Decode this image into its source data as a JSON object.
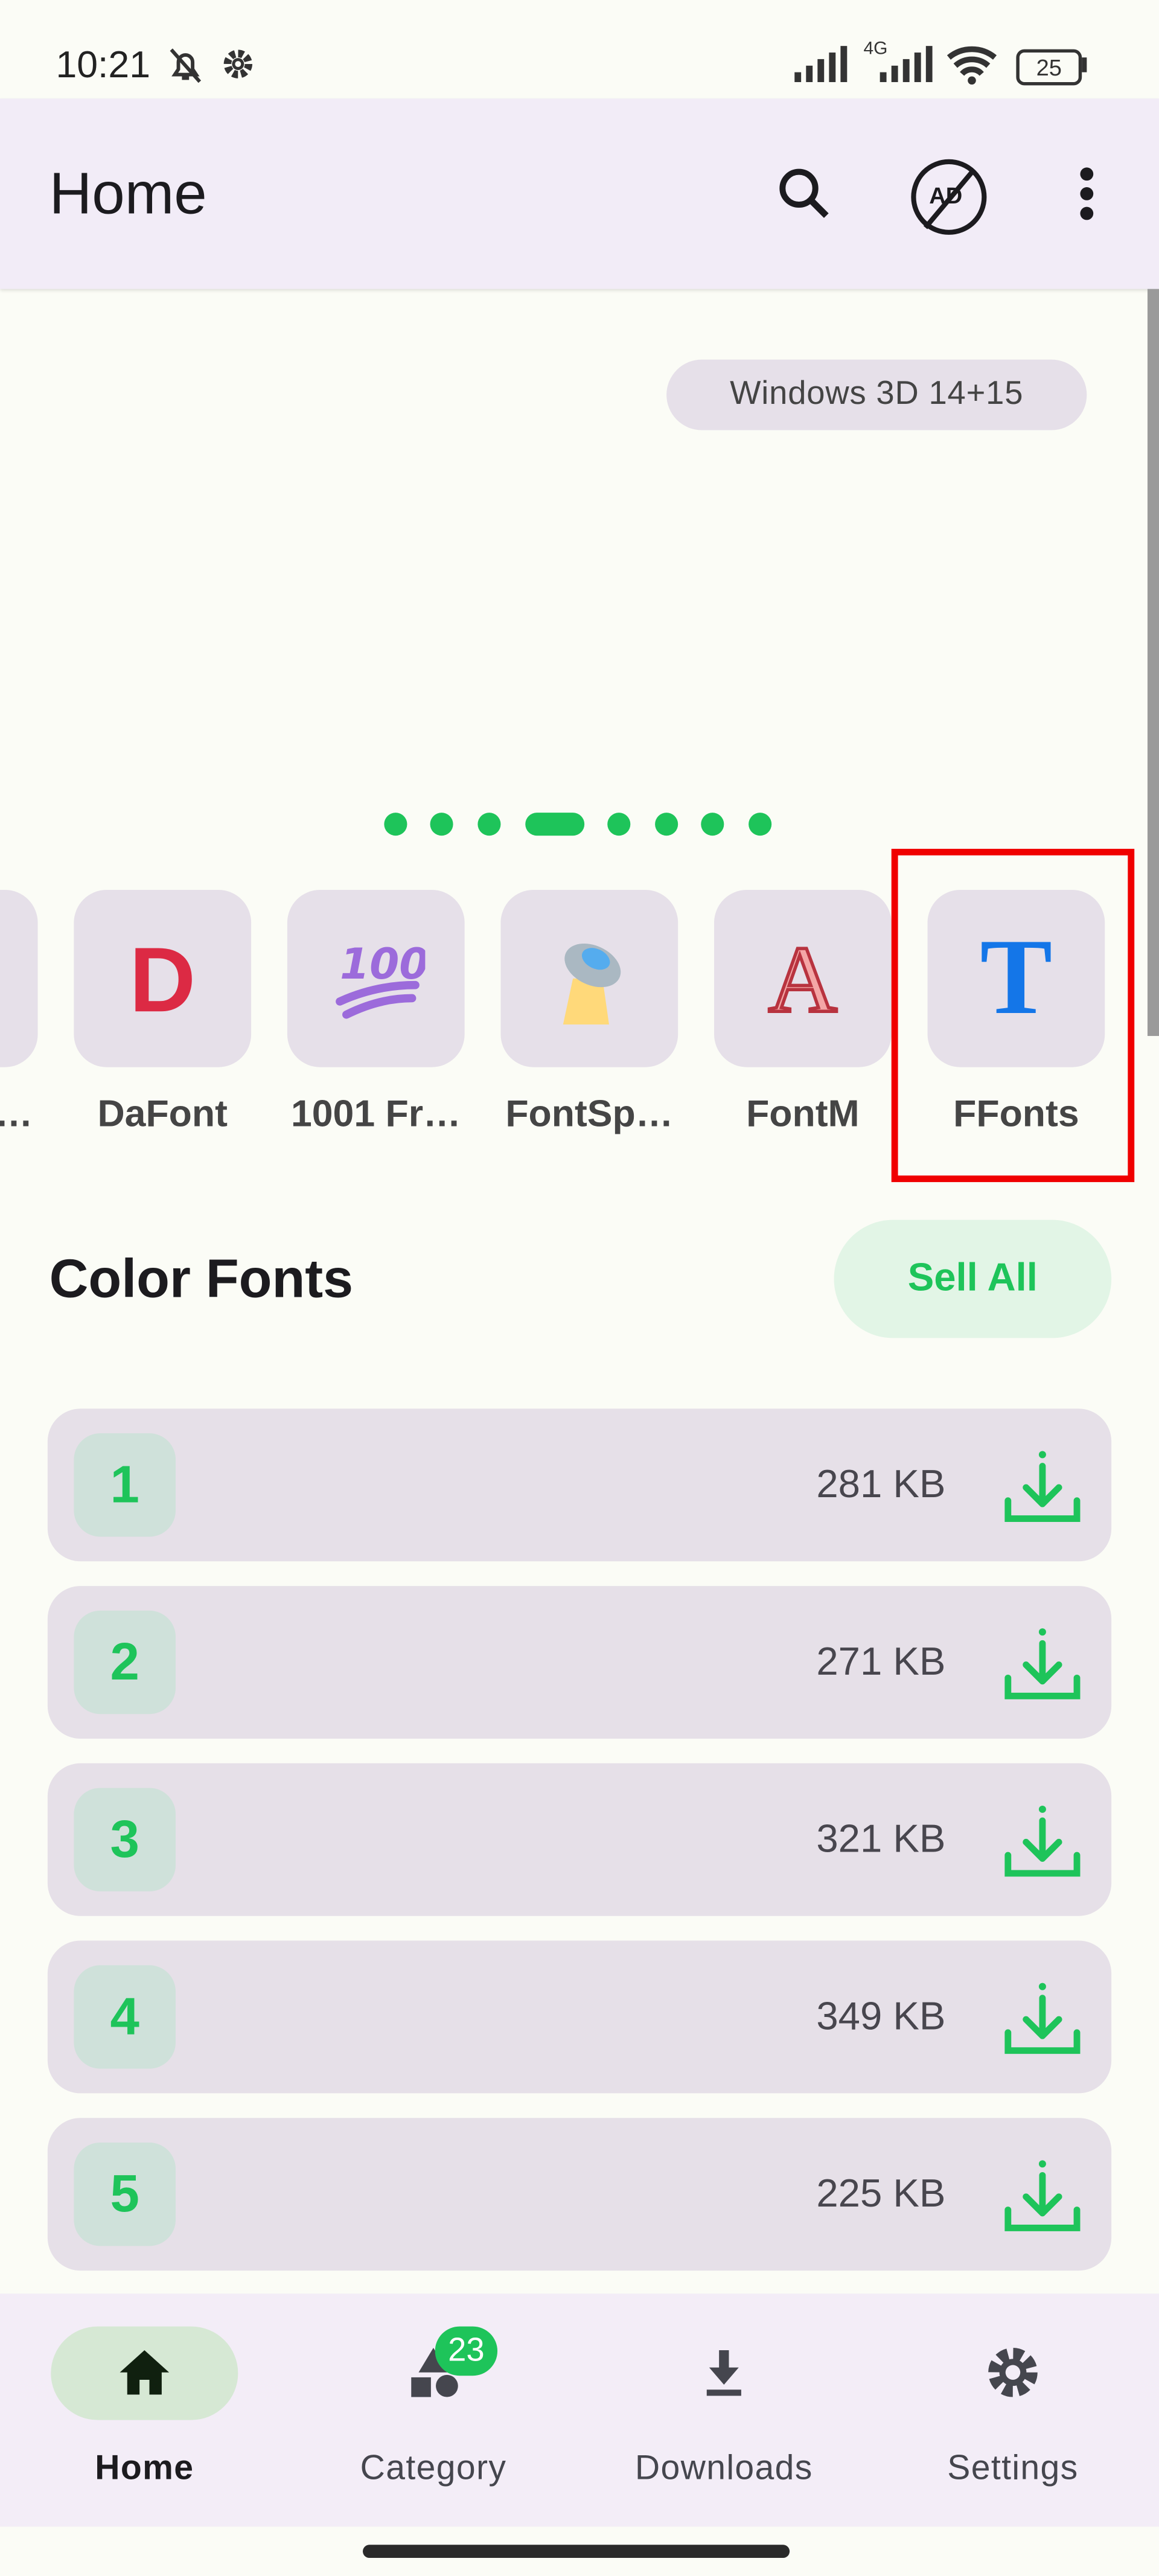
{
  "status_bar": {
    "time": "10:21",
    "network": "4G",
    "battery": "25"
  },
  "app_bar": {
    "title": "Home",
    "icons": [
      "search-icon",
      "no-ads-icon",
      "more-vert-icon"
    ]
  },
  "banner": {
    "chip_label": "Windows 3D 14+15",
    "page_count": 8,
    "active_page": 4,
    "accent": "#1ec45a"
  },
  "sources": [
    {
      "label": "q…",
      "icon": "partial-icon"
    },
    {
      "label": "DaFont",
      "icon": "d-letter-icon"
    },
    {
      "label": "1001 Fr…",
      "icon": "hundred-emoji-icon"
    },
    {
      "label": "FontSp…",
      "icon": "ufo-icon"
    },
    {
      "label": "FontM",
      "icon": "a-letter-icon"
    },
    {
      "label": "FFonts",
      "icon": "t-letter-icon",
      "highlighted": true
    }
  ],
  "section": {
    "title": "Color Fonts",
    "action_label": "Sell All",
    "items": [
      {
        "number": "1",
        "size": "281 KB"
      },
      {
        "number": "2",
        "size": "271 KB"
      },
      {
        "number": "3",
        "size": "321 KB"
      },
      {
        "number": "4",
        "size": "349 KB"
      },
      {
        "number": "5",
        "size": "225 KB"
      }
    ]
  },
  "bottom_nav": {
    "items": [
      {
        "label": "Home",
        "active": true
      },
      {
        "label": "Category",
        "badge": "23"
      },
      {
        "label": "Downloads"
      },
      {
        "label": "Settings"
      }
    ]
  },
  "colors": {
    "accent": "#1ec45a",
    "highlight": "#f00000",
    "app_bar": "#f2ecf7"
  }
}
